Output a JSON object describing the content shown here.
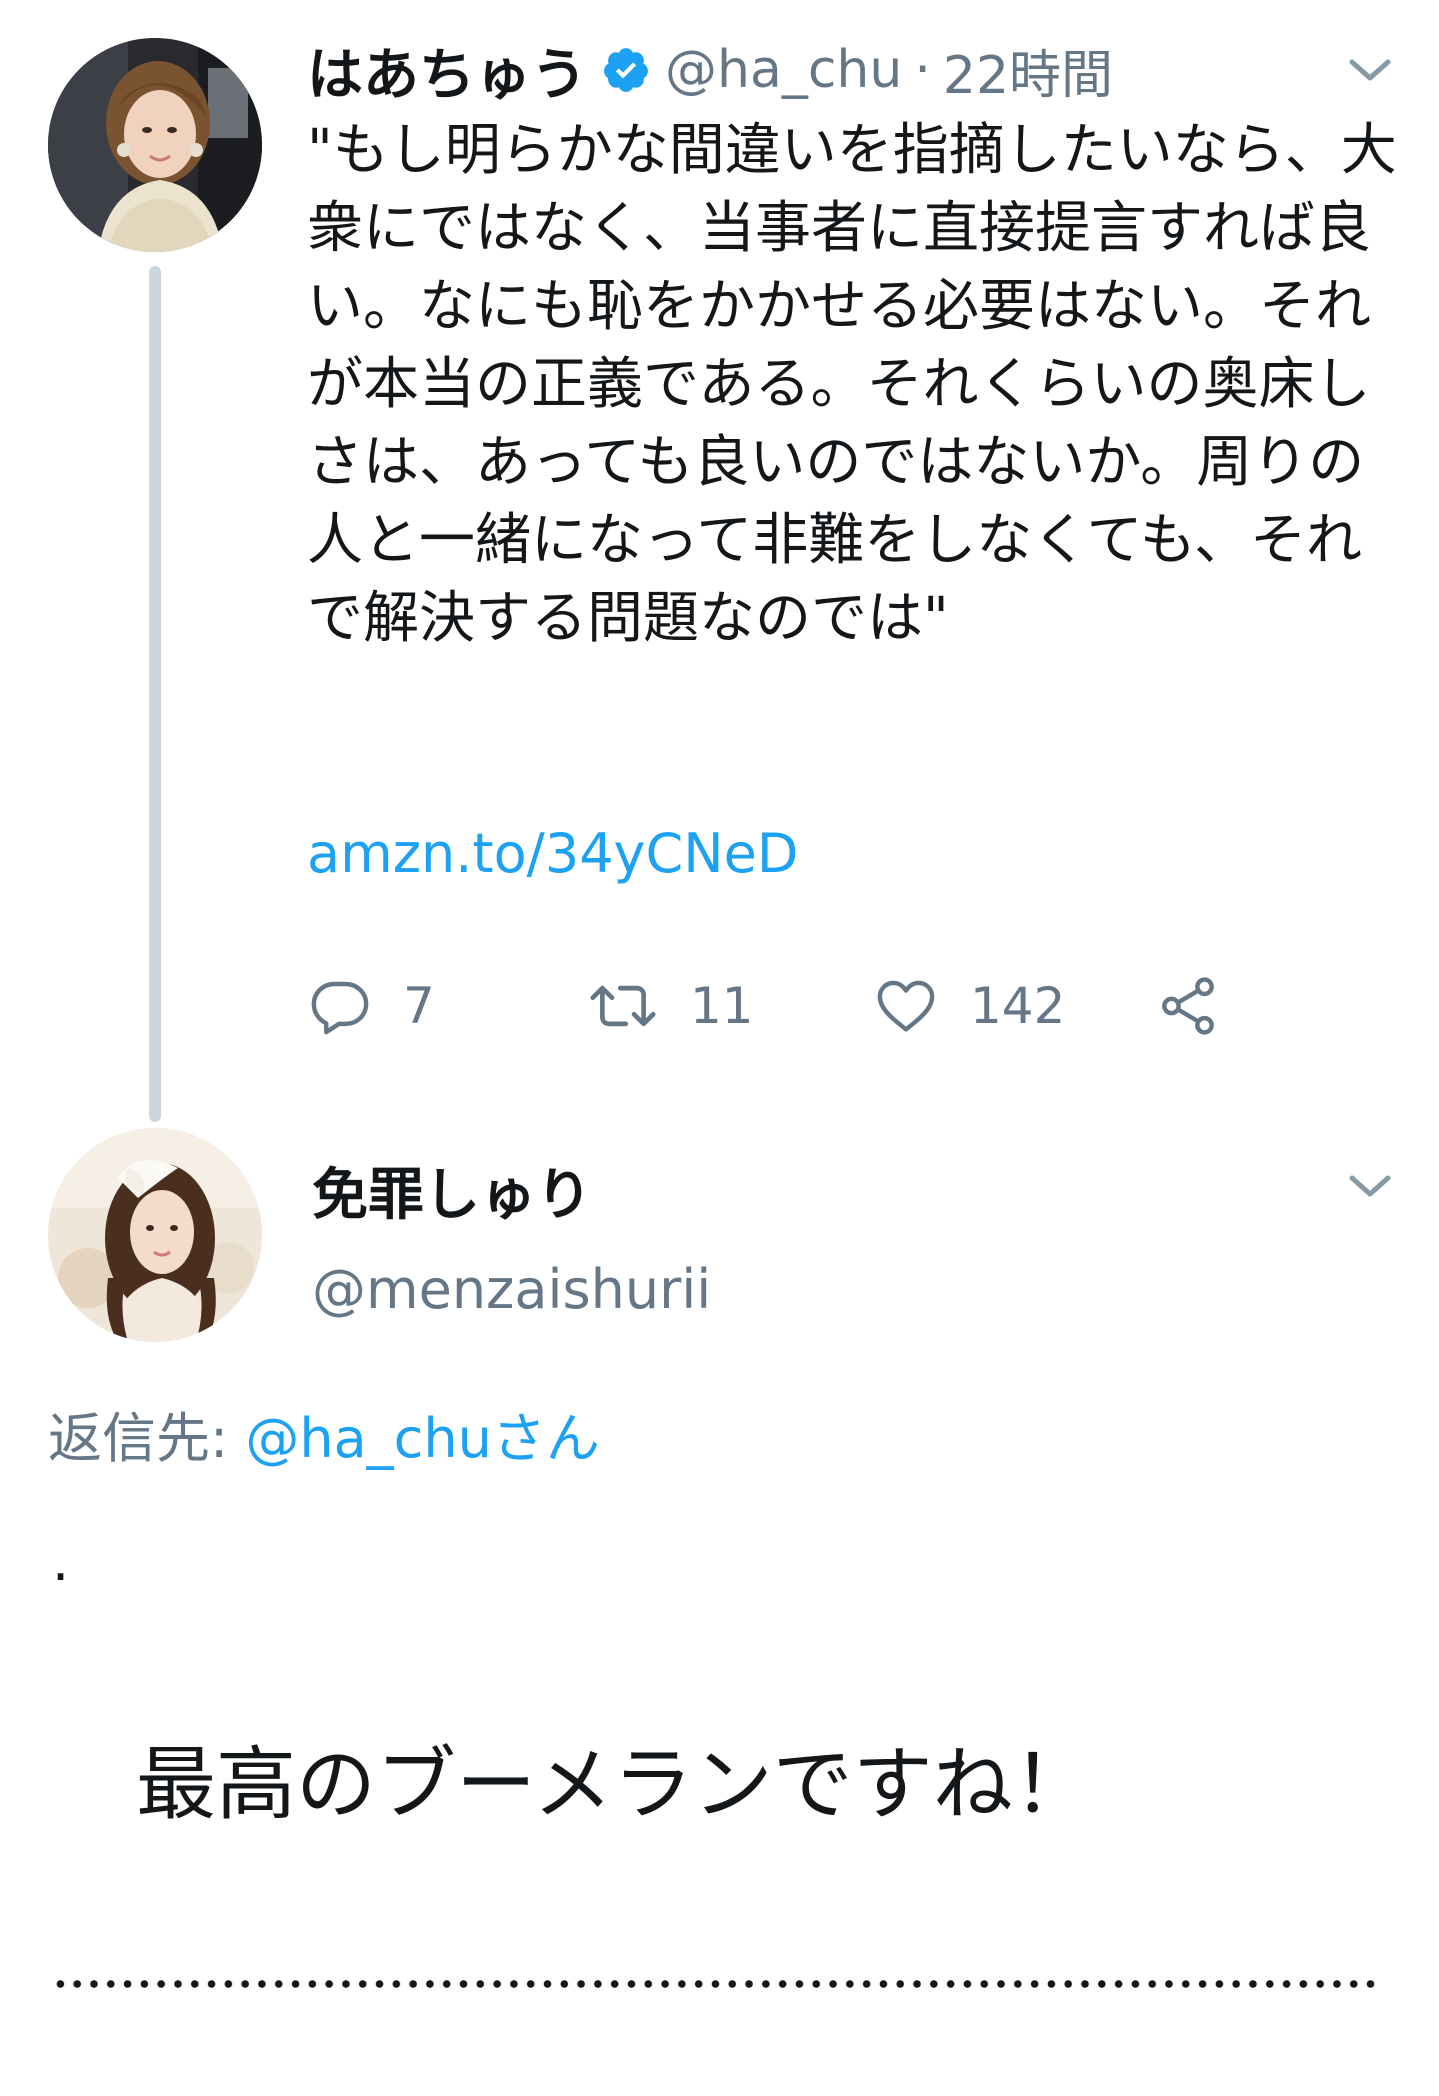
{
  "tweet1": {
    "display_name": "はあちゅう",
    "verified": true,
    "handle": "@ha_chu",
    "separator": "·",
    "time": "22時間",
    "text": "\"もし明らかな間違いを指摘したいなら、大衆にではなく、当事者に直接提言すれば良い。なにも恥をかかせる必要はない。それが本当の正義である。それくらいの奥床しさは、あっても良いのではないか。周りの人と一緒になって非難をしなくても、それで解決する問題なのでは\"",
    "link": "amzn.to/34yCNeD",
    "actions": {
      "reply_count": "7",
      "retweet_count": "11",
      "like_count": "142"
    },
    "icons": {
      "reply": "reply-icon",
      "retweet": "retweet-icon",
      "like": "heart-icon",
      "share": "share-icon",
      "menu": "chevron-down-icon",
      "verified": "verified-badge-icon"
    }
  },
  "tweet2": {
    "display_name": "免罪しゅり",
    "handle": "@menzaishurii",
    "reply_label": "返信先: ",
    "reply_mention": "@ha_chuさん",
    "dot": ".",
    "body": "最高のブーメランですね！"
  },
  "colors": {
    "text": "#14171a",
    "secondary": "#657786",
    "link": "#1da1f2",
    "thread_line": "#ccd6dd",
    "verified": "#1da1f2"
  }
}
